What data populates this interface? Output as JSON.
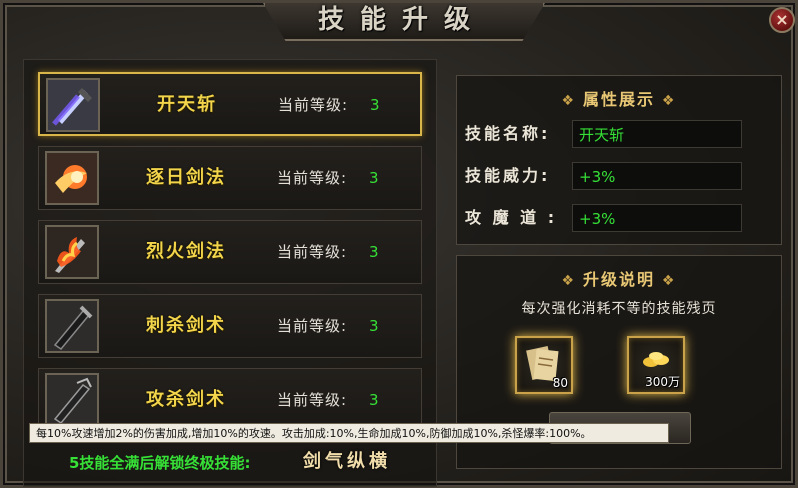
{
  "window": {
    "title": "技能升级",
    "close_symbol": "×"
  },
  "skills": [
    {
      "name": "开天斩",
      "level_label": "当前等级:",
      "level": "3",
      "icon": "sword-slash-purple-icon",
      "selected": true
    },
    {
      "name": "逐日剑法",
      "level_label": "当前等级:",
      "level": "3",
      "icon": "sun-fire-slash-icon",
      "selected": false
    },
    {
      "name": "烈火剑法",
      "level_label": "当前等级:",
      "level": "3",
      "icon": "flame-sword-icon",
      "selected": false
    },
    {
      "name": "刺杀剑术",
      "level_label": "当前等级:",
      "level": "3",
      "icon": "thrust-sword-icon",
      "selected": false
    },
    {
      "name": "攻杀剑术",
      "level_label": "当前等级:",
      "level": "3",
      "icon": "attack-sword-icon",
      "selected": false
    }
  ],
  "tooltip": "每10%攻速增加2%的伤害加成,增加10%的攻速。攻击加成:10%,生命加成10%,防御加成10%,杀怪爆率:100%。",
  "bottom": {
    "note": "5技能全满后解锁终极技能:",
    "ultimate": "剑气纵横"
  },
  "attributes": {
    "title": "属性展示",
    "rows": [
      {
        "label": "技能名称:",
        "value": "开天斩"
      },
      {
        "label": "技能威力:",
        "value": "+3%"
      },
      {
        "label": "攻 魔 道 :",
        "value": "+3%"
      }
    ]
  },
  "upgrade": {
    "title": "升级说明",
    "description": "每次强化消耗不等的技能残页",
    "costs": [
      {
        "icon": "skill-page-scroll-icon",
        "count": "80"
      },
      {
        "icon": "gold-coins-icon",
        "count": "300万"
      }
    ]
  },
  "colors": {
    "accent_gold": "#d8b64a",
    "skill_name": "#f2d54a",
    "value_green": "#36e036"
  }
}
